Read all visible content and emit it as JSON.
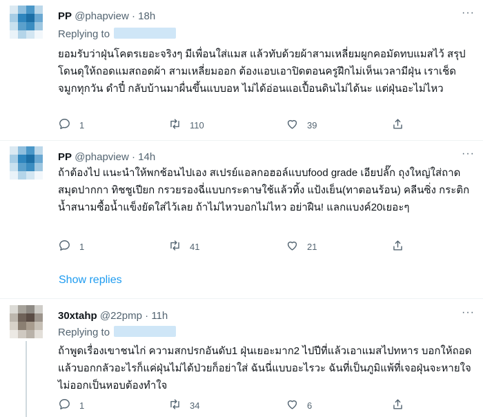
{
  "tweets": [
    {
      "name": "PP",
      "handle": "@phapview",
      "separator": "·",
      "time": "18h",
      "replying_to": "Replying to",
      "text": "ยอมรับว่าฝุ่นโคตรเยอะจริงๆ มีเพื่อนใส่แมส แล้วทับด้วยผ้าสามเหลี่ยมผูกคอมัดทบแมสไว้ สรุปโดนดุให้ถอดแมสถอดผ้า สามเหลี่ยมออก ต้องแอบเอาปิดตอนครูฝึกไม่เห็นเวลามีฝุ่น เราเช็ดจมูกทุกวัน ดำปี๋ กลับบ้านมาผื่นขึ้นแบบอห ไม่ได้อ่อนแอเปื้อนดินไม่ได้นะ แต่ฝุ่นอะไม่ไหว",
      "replies": "1",
      "retweets": "110",
      "likes": "39"
    },
    {
      "name": "PP",
      "handle": "@phapview",
      "separator": "·",
      "time": "14h",
      "text": "ถ้าต้องไป แนะนำให้พกช้อนไปเอง สเปรย์แอลกอฮอล์แบบfood grade เอียปลั๊ก ถุงใหญ่ใส่ถาด สมุดปากกา ทิชชูเปียก กรวยรองฉี่แบบกระดาษใช้แล้วทิ้ง แป้งเย็น(ทาตอนร้อน) คลีนซิ่ง กระติกน้ำสนามซื้อน้ำแข็งยัดใส่ไว้เลย ถ้าไม่ไหวบอกไม่ไหว อย่าฝืน! แลกแบงค์20เยอะๆ",
      "replies": "1",
      "retweets": "41",
      "likes": "21"
    },
    {
      "name": "30xtahp",
      "handle": "@22pmp",
      "separator": "·",
      "time": "11h",
      "replying_to": "Replying to",
      "text": "ถ้าพูดเรื่องเขาชนไก่ ความสกปรกอันดับ1 ฝุ่นเยอะมาก2 ไปปีที่แล้วเอาแมสไปทหาร บอกให้ถอดแล้วบอกกลัวอะไรก็แค่ฝุ่นไม่ได้ป่วยก็อย่าใส่ ฉันนี่แบบอะไรวะ ฉันที่เป็นภูมิแพ้ที่เจอฝุ่นจะหายใจไม่ออกเป็นหอบต้องทำใจ",
      "replies": "1",
      "retweets": "34",
      "likes": "6"
    }
  ],
  "show_replies": "Show replies",
  "icons": {
    "reply": "reply-icon",
    "retweet": "retweet-icon",
    "like": "like-icon",
    "share": "share-icon",
    "more": "more-icon"
  },
  "colors": {
    "link": "#1d9bf0",
    "muted": "#536471",
    "text": "#0f1419",
    "mention_blur": "#cfe6f7"
  }
}
